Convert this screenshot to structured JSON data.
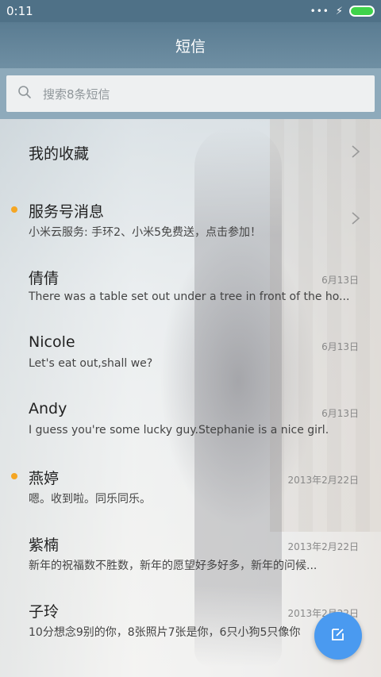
{
  "status_bar": {
    "time": "0:11",
    "signal": "•••",
    "charging_icon": "⚡",
    "battery_color": "#3fd34a"
  },
  "title": "短信",
  "search": {
    "placeholder": "搜索8条短信"
  },
  "conversations": [
    {
      "name": "我的收藏",
      "preview": "",
      "date": "",
      "unread": false,
      "chevron": true
    },
    {
      "name": "服务号消息",
      "preview": "小米云服务: 手环2、小米5免费送，点击参加！",
      "date": "",
      "unread": true,
      "chevron": true
    },
    {
      "name": "倩倩",
      "preview": "There was a table set out under a tree in front of the ho...",
      "date": "6月13日",
      "unread": false,
      "chevron": false
    },
    {
      "name": "Nicole",
      "preview": "Let's eat out,shall we?",
      "date": "6月13日",
      "unread": false,
      "chevron": false
    },
    {
      "name": "Andy",
      "preview": "I guess you're some lucky guy.Stephanie is a nice girl.",
      "date": "6月13日",
      "unread": false,
      "chevron": false
    },
    {
      "name": "燕婷",
      "preview": "嗯。收到啦。同乐同乐。",
      "date": "2013年2月22日",
      "unread": true,
      "chevron": false
    },
    {
      "name": "紫楠",
      "preview": "新年的祝福数不胜数，新年的愿望好多好多，新年的问候...",
      "date": "2013年2月22日",
      "unread": false,
      "chevron": false
    },
    {
      "name": "子玲",
      "preview": "10分想念9别的你，8张照片7张是你，6只小狗5只像你",
      "date": "2013年2月22日",
      "unread": false,
      "chevron": false
    }
  ],
  "icons": {
    "search": "search-icon",
    "compose": "compose-icon",
    "chevron": "chevron-right-icon"
  },
  "colors": {
    "accent": "#4a9af0",
    "unread": "#f5a623",
    "titlebar": "#5a7c92"
  }
}
